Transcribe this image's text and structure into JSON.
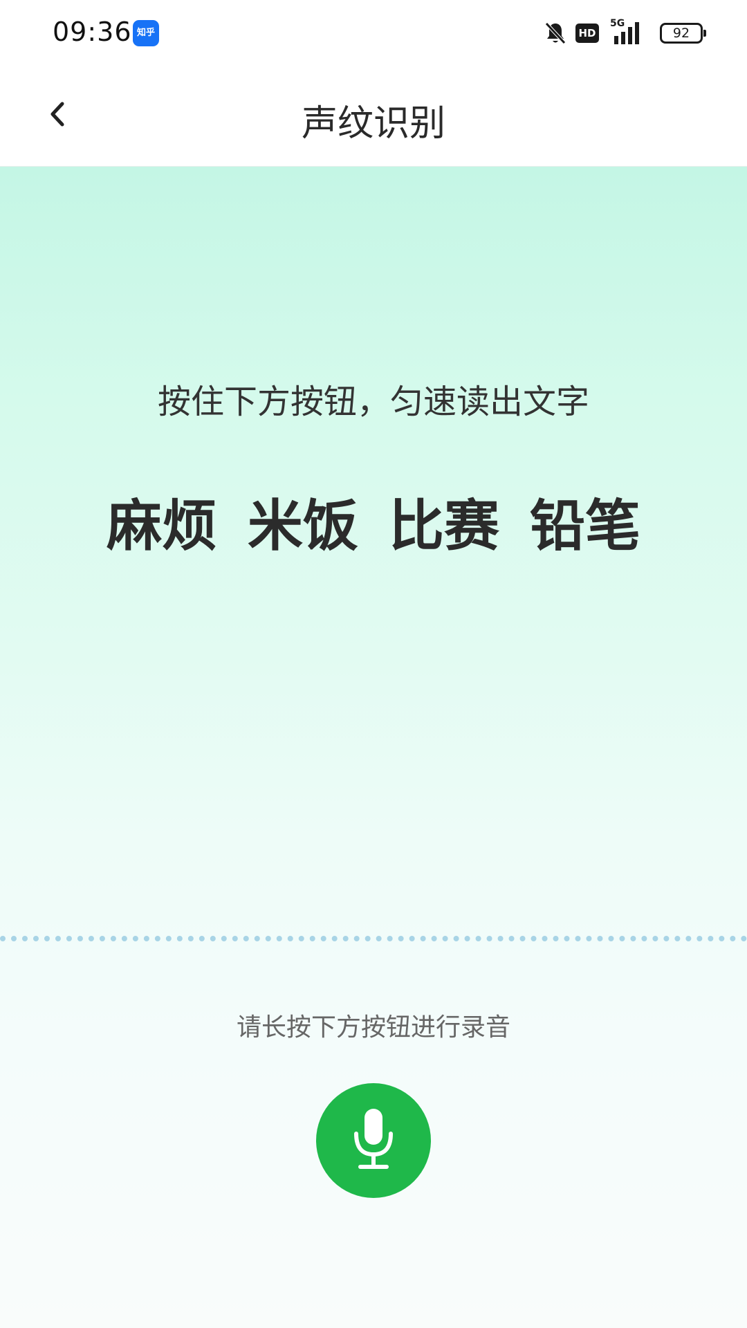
{
  "status_bar": {
    "time": "09:36",
    "app_badge": "知乎",
    "icons": [
      "bell-muted-icon",
      "hd-badge",
      "signal-5g-icon",
      "battery-icon"
    ],
    "hd_label": "HD",
    "network_label": "5G",
    "battery_level": "92"
  },
  "header": {
    "title": "声纹识别",
    "back_icon": "chevron-left-icon"
  },
  "main": {
    "instruction": "按住下方按钮，匀速读出文字",
    "words": [
      "麻烦",
      "米饭",
      "比赛",
      "铅笔"
    ],
    "hint": "请长按下方按钮进行录音",
    "record_icon": "microphone-icon"
  },
  "colors": {
    "accent": "#1fb84a",
    "brand_badge": "#1772f6",
    "gradient_top": "#c4f6e5",
    "gradient_bottom": "#f9fcfb",
    "divider": "#a8d4e6"
  }
}
